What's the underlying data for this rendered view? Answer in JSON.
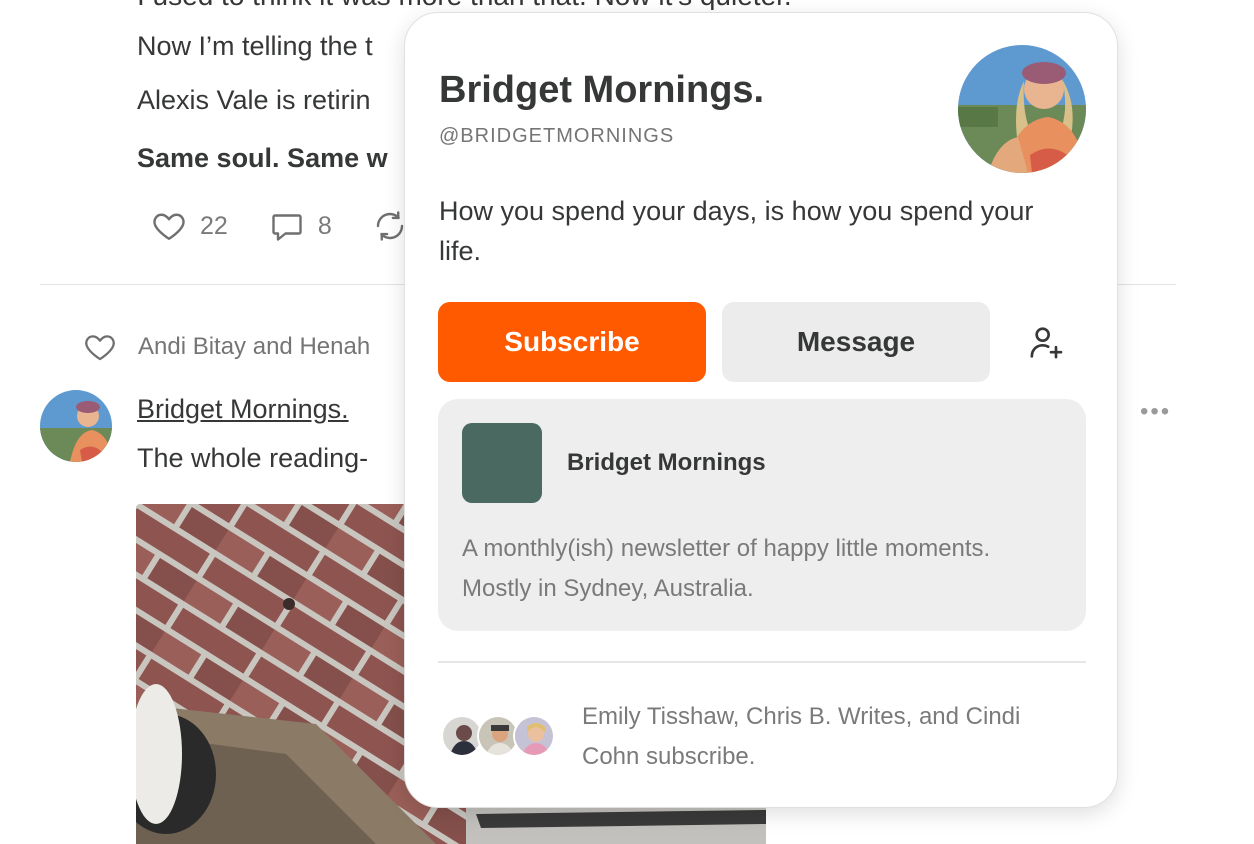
{
  "feed": {
    "post_lines": {
      "partial_top": "I used to think it was more than that. Now it’s quieter.",
      "line1": "Now I’m telling the t",
      "line2": "Alexis Vale is retirin",
      "line3": "Same soul. Same w"
    },
    "actions": {
      "likes": "22",
      "comments": "8"
    },
    "next_post": {
      "liked_by": "Andi Bitay and Henah",
      "author": "Bridget Mornings.",
      "body": "The whole reading-"
    }
  },
  "card": {
    "name": "Bridget Mornings.",
    "handle": "@BRIDGETMORNINGS",
    "bio": "How you spend your days, is how you spend your life.",
    "subscribe_label": "Subscribe",
    "message_label": "Message",
    "follow_icon": "person-add-icon",
    "publication": {
      "name": "Bridget Mornings",
      "description": "A monthly(ish) newsletter of happy little moments. Mostly in Sydney, Australia."
    },
    "subscribers_text": "Emily Tisshaw, Chris B. Writes, and Cindi Cohn subscribe."
  },
  "colors": {
    "accent": "#ff5a00",
    "publication_logo": "#4a6960",
    "text": "#363737",
    "muted": "#757575"
  }
}
